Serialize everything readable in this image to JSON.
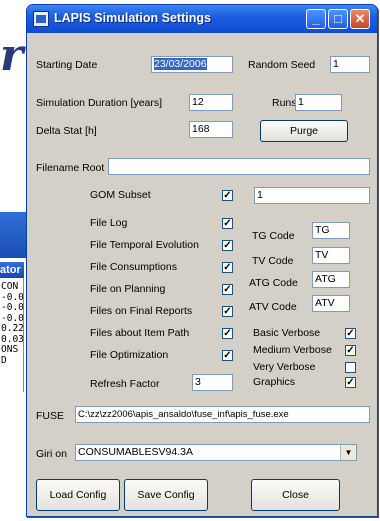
{
  "background": {
    "letter": "r",
    "panel_title": "ator",
    "panel_lines": [
      "CON",
      "-0.0",
      "-0.0",
      "-0.0",
      "0.22",
      "0.03",
      "ONS",
      "D"
    ]
  },
  "window": {
    "title": "LAPIS Simulation Settings",
    "buttons": {
      "minimize": "_",
      "maximize": "□",
      "close": "✕"
    }
  },
  "form": {
    "starting_date": {
      "label": "Starting Date",
      "value": "23/03/2006"
    },
    "random_seed": {
      "label": "Random Seed",
      "value": "1"
    },
    "duration": {
      "label": "Simulation Duration [years]",
      "value": "12"
    },
    "runs": {
      "label": "Runs",
      "value": "1"
    },
    "delta_stat": {
      "label": "Delta Stat [h]",
      "value": "168"
    },
    "purge_button": "Purge",
    "filename_root": {
      "label": "Filename Root",
      "value": ""
    },
    "gom_subset": {
      "label": "GOM Subset",
      "checked": true,
      "value": "1"
    },
    "file_options": [
      {
        "label": "File Log",
        "checked": true
      },
      {
        "label": "File Temporal Evolution",
        "checked": true
      },
      {
        "label": "File Consumptions",
        "checked": true
      },
      {
        "label": "File on Planning",
        "checked": true
      },
      {
        "label": "Files on Final Reports",
        "checked": true
      },
      {
        "label": "Files about Item Path",
        "checked": true
      },
      {
        "label": "File Optimization",
        "checked": true
      }
    ],
    "codes": [
      {
        "label": "TG Code",
        "value": "TG"
      },
      {
        "label": "TV Code",
        "value": "TV"
      },
      {
        "label": "ATG Code",
        "value": "ATG"
      },
      {
        "label": "ATV Code",
        "value": "ATV"
      }
    ],
    "verbose": [
      {
        "label": "Basic Verbose",
        "checked": true
      },
      {
        "label": "Medium Verbose",
        "checked": true
      },
      {
        "label": "Very Verbose",
        "checked": false
      },
      {
        "label": "Graphics",
        "checked": true
      }
    ],
    "refresh_factor": {
      "label": "Refresh Factor",
      "value": "3"
    },
    "fuse": {
      "label": "FUSE",
      "value": "C:\\zz\\zz2006\\apis_ansaldo\\fuse_inf\\apis_fuse.exe"
    },
    "giri_on": {
      "label": "Giri on",
      "value": "CONSUMABLESV94.3A"
    }
  },
  "footer": {
    "load_config": "Load Config",
    "save_config": "Save Config",
    "close": "Close"
  },
  "check_glyph": "✓"
}
